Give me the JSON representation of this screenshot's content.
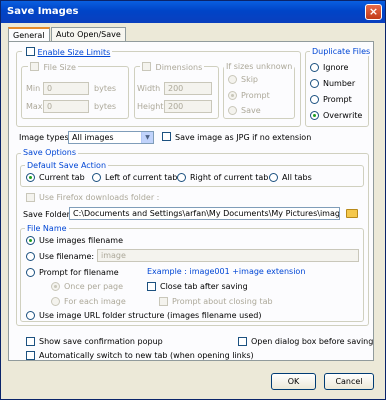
{
  "window": {
    "title": "Save Images",
    "close_glyph": "×"
  },
  "tabs": [
    "General",
    "Auto Open/Save"
  ],
  "size_limits": {
    "checkbox_label": "Enable Size Limits",
    "file_size_legend": "File Size",
    "min_label": "Min",
    "min_value": "0",
    "min_unit": "bytes",
    "max_label": "Max",
    "max_value": "0",
    "max_unit": "bytes",
    "dimensions_legend": "Dimensions",
    "width_label": "Width",
    "width_value": "200",
    "height_label": "Height",
    "height_value": "200",
    "unknown_legend": "If sizes unknown",
    "unknown_options": [
      "Skip",
      "Prompt",
      "Save"
    ]
  },
  "duplicate": {
    "legend": "Duplicate Files",
    "options": [
      "Ignore",
      "Number",
      "Prompt",
      "Overwrite"
    ]
  },
  "image_types": {
    "label": "Image types",
    "value": "All images",
    "jpg_label": "Save image as JPG if no extension"
  },
  "save_options": {
    "legend": "Save Options",
    "default_action_legend": "Default Save Action",
    "actions": [
      "Current tab",
      "Left of current tab",
      "Right of current tab",
      "All tabs"
    ],
    "firefox_folder_label": "Use Firefox downloads folder :",
    "folder_label": "Save Folder",
    "folder_value": "C:\\Documents and Settings\\arfan\\My Documents\\My Pictures\\image",
    "folder_icon": "folder-icon"
  },
  "file_name": {
    "legend": "File Name",
    "use_images_filename": "Use images filename",
    "use_filename": "Use filename:",
    "filename_value": "image",
    "prompt_for_filename": "Prompt for filename",
    "example": "Example :   image001 +image extension",
    "once_per_page": "Once per page",
    "for_each_image": "For each image",
    "close_tab": "Close tab after saving",
    "prompt_closing": "Prompt about closing tab",
    "url_structure": "Use image URL folder structure (images filename used)"
  },
  "bottom": {
    "confirm_popup": "Show save confirmation popup",
    "open_dialog": "Open dialog box before saving",
    "auto_switch": "Automatically switch to new tab (when opening links)"
  },
  "buttons": {
    "ok": "OK",
    "cancel": "Cancel"
  },
  "colors": {
    "accent": "#0046d5",
    "title_bar": "#0a5fe0",
    "radio_dot": "#21a121"
  }
}
